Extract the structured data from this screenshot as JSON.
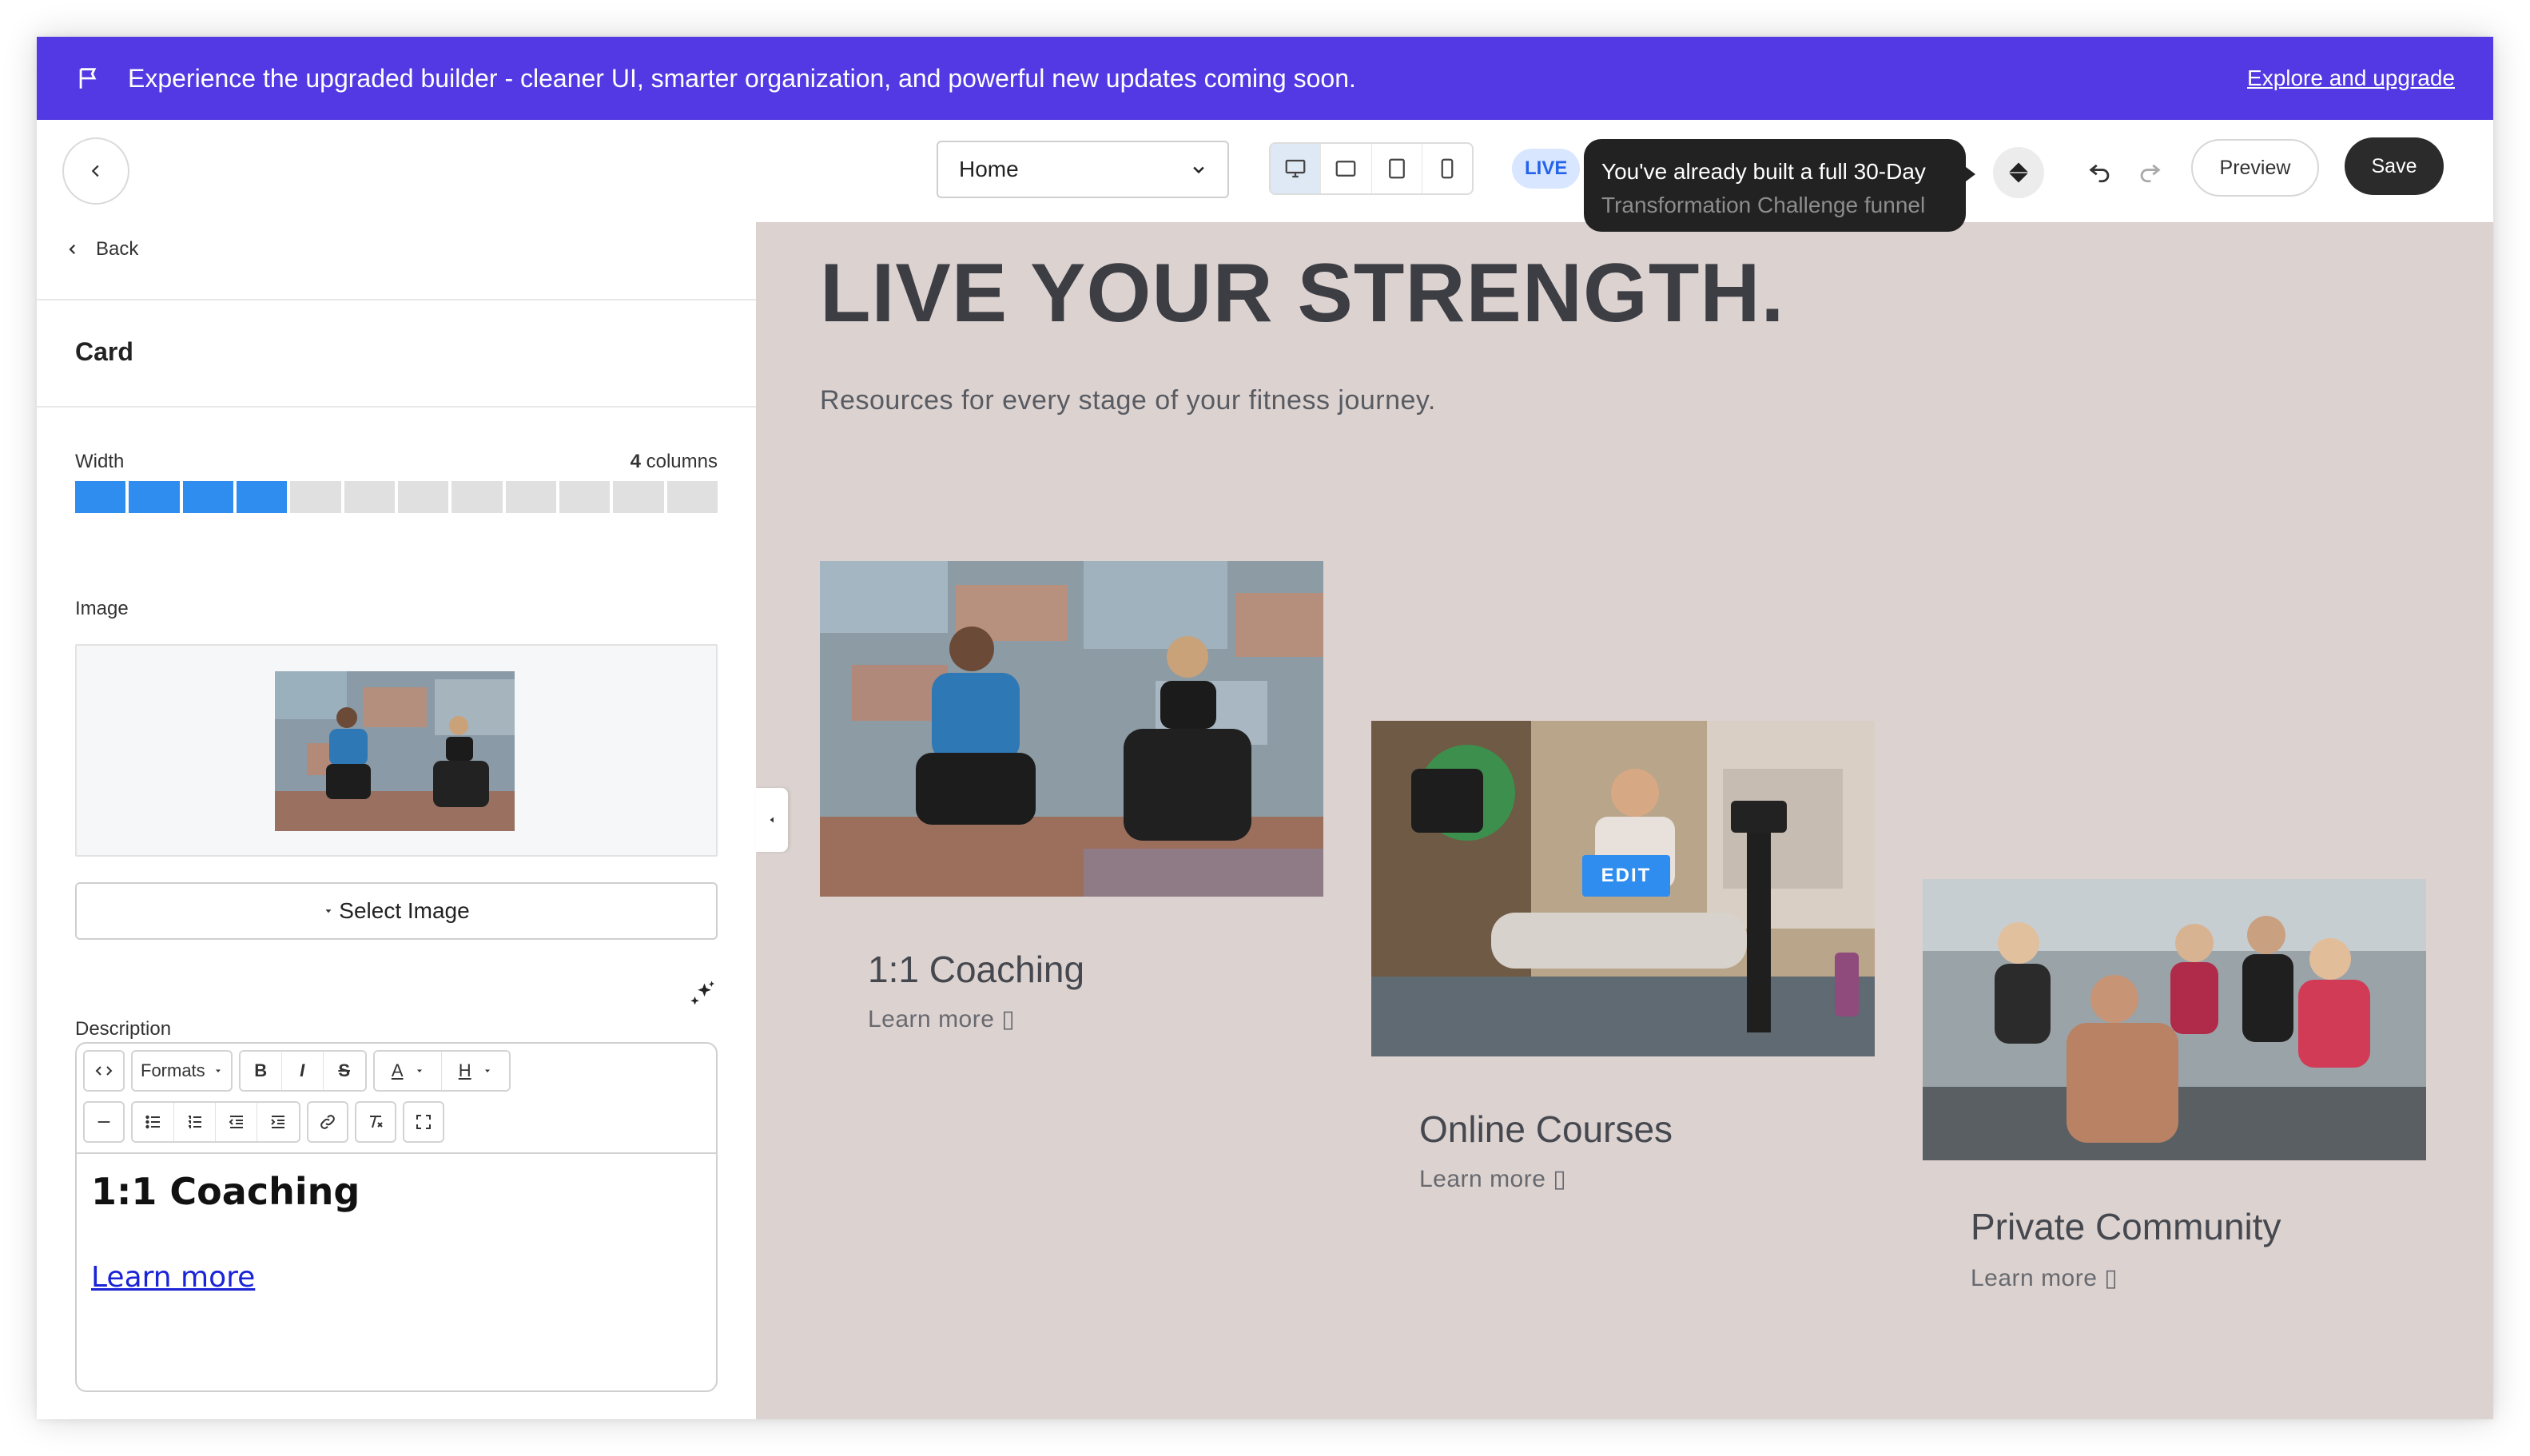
{
  "banner": {
    "message": "Experience the upgraded builder - cleaner UI, smarter organization, and powerful new updates coming soon.",
    "link": "Explore and upgrade",
    "bg_color": "#5339e3"
  },
  "toolbar": {
    "page_selected": "Home",
    "devices": [
      "desktop-icon",
      "tablet-landscape-icon",
      "tablet-icon",
      "mobile-icon"
    ],
    "live_label": "LIVE",
    "tooltip_line1": "You've already built a full 30-Day",
    "tooltip_line2": "Transformation Challenge funnel",
    "preview_label": "Preview",
    "save_label": "Save"
  },
  "panel": {
    "back_label": "Back",
    "section_title": "Card",
    "width_label": "Width",
    "width_columns_value": "4",
    "width_columns_unit": "columns",
    "width_filled": 4,
    "width_total": 12,
    "image_label": "Image",
    "select_image_label": "Select Image",
    "description_label": "Description",
    "editor": {
      "formats_label": "Formats",
      "bold": "B",
      "italic": "I",
      "strike": "S",
      "font_color": "A",
      "heading": "H",
      "content_heading": "1:1 Coaching",
      "content_link": "Learn more"
    }
  },
  "canvas": {
    "hero_title": "LIVE YOUR STRENGTH.",
    "hero_subtitle": "Resources for every stage of your fitness journey.",
    "edit_badge": "EDIT",
    "cards": [
      {
        "title": "1:1 Coaching",
        "link": "Learn more ▯"
      },
      {
        "title": "Online Courses",
        "link": "Learn more ▯"
      },
      {
        "title": "Private Community",
        "link": "Learn more ▯"
      }
    ],
    "bg_color": "#dcd2d0"
  },
  "colors": {
    "accent_blue": "#2f8df0",
    "save_dark": "#2b2b2b"
  }
}
